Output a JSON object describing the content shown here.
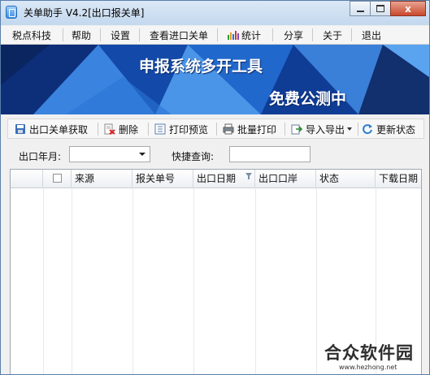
{
  "window": {
    "title": "关单助手  V4.2[出口报关单]",
    "close_glyph": "x"
  },
  "menu": {
    "items": [
      "税点科技",
      "帮助",
      "设置",
      "查看进口关单",
      "统计",
      "分享",
      "关于",
      "退出"
    ]
  },
  "banner": {
    "title": "申报系统多开工具",
    "subtitle": "免费公测中"
  },
  "toolbar": {
    "fetch_label": "出口关单获取",
    "delete_label": "删除",
    "print_preview_label": "打印预览",
    "batch_print_label": "批量打印",
    "import_export_label": "导入导出",
    "update_status_label": "更新状态"
  },
  "filters": {
    "month_label": "出口年月:",
    "month_value": "",
    "quick_query_label": "快捷查询:",
    "quick_query_value": ""
  },
  "grid": {
    "columns": [
      "",
      "来源",
      "报关单号",
      "出口日期",
      "出口口岸",
      "状态",
      "下载日期"
    ],
    "rows": []
  },
  "watermark": {
    "text": "合众软件园",
    "url": "www.hezhong.net"
  },
  "colors": {
    "banner_blue": "#1a5fc0",
    "close_red": "#c9492c"
  }
}
